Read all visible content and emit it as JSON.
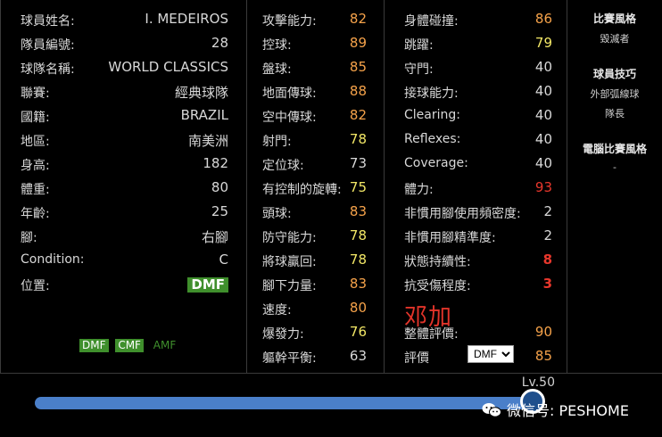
{
  "colors": {
    "orange": "#f5a24a",
    "yellow": "#f2e766",
    "white": "#d8d8d8",
    "red": "#e8372c",
    "badge": "#3f8f2c"
  },
  "profile": [
    {
      "label": "球員姓名:",
      "value": "I. MEDEIROS"
    },
    {
      "label": "隊員編號:",
      "value": "28"
    },
    {
      "label": "球隊名稱:",
      "value": "WORLD CLASSICS"
    },
    {
      "label": "聯賽:",
      "value": "經典球隊"
    },
    {
      "label": "國籍:",
      "value": "BRAZIL"
    },
    {
      "label": "地區:",
      "value": "南美洲"
    },
    {
      "label": "身高:",
      "value": "182"
    },
    {
      "label": "體重:",
      "value": "80"
    },
    {
      "label": "年齡:",
      "value": "25"
    },
    {
      "label": "腳:",
      "value": "右腳"
    },
    {
      "label": "Condition:",
      "value": "C"
    },
    {
      "label": "位置:",
      "value": "DMF"
    }
  ],
  "positions": [
    "DMF",
    "CMF",
    "AMF"
  ],
  "stats_a": [
    {
      "label": "攻擊能力:",
      "value": "82",
      "color": "orange"
    },
    {
      "label": "控球:",
      "value": "89",
      "color": "orange"
    },
    {
      "label": "盤球:",
      "value": "85",
      "color": "orange"
    },
    {
      "label": "地面傳球:",
      "value": "88",
      "color": "orange"
    },
    {
      "label": "空中傳球:",
      "value": "82",
      "color": "orange"
    },
    {
      "label": "射門:",
      "value": "78",
      "color": "yellow"
    },
    {
      "label": "定位球:",
      "value": "73",
      "color": "white"
    },
    {
      "label": "有控制的旋轉:",
      "value": "75",
      "color": "yellow"
    },
    {
      "label": "頭球:",
      "value": "83",
      "color": "orange"
    },
    {
      "label": "防守能力:",
      "value": "78",
      "color": "yellow"
    },
    {
      "label": "將球贏回:",
      "value": "78",
      "color": "yellow"
    },
    {
      "label": "腳下力量:",
      "value": "83",
      "color": "orange"
    },
    {
      "label": "速度:",
      "value": "80",
      "color": "orange"
    },
    {
      "label": "爆發力:",
      "value": "76",
      "color": "yellow"
    },
    {
      "label": "軀幹平衡:",
      "value": "63",
      "color": "white"
    }
  ],
  "stats_b": [
    {
      "label": "身體碰撞:",
      "value": "86",
      "color": "orange"
    },
    {
      "label": "跳躍:",
      "value": "79",
      "color": "yellow"
    },
    {
      "label": "守門:",
      "value": "40",
      "color": "white"
    },
    {
      "label": "接球能力:",
      "value": "40",
      "color": "white"
    },
    {
      "label": "Clearing:",
      "value": "40",
      "color": "white"
    },
    {
      "label": "Reflexes:",
      "value": "40",
      "color": "white"
    },
    {
      "label": "Coverage:",
      "value": "40",
      "color": "white"
    },
    {
      "label": "體力:",
      "value": "93",
      "color": "red"
    },
    {
      "label": "非慣用腳使用頻密度:",
      "value": "2",
      "color": "white"
    },
    {
      "label": "非慣用腳精準度:",
      "value": "2",
      "color": "white"
    },
    {
      "label": "狀態持續性:",
      "value": "8",
      "color": "red",
      "bold": true
    },
    {
      "label": "抗受傷程度:",
      "value": "3",
      "color": "red",
      "bold": true
    },
    {
      "label": "",
      "value": "",
      "color": "white"
    },
    {
      "label": "整體評價:",
      "value": "90",
      "color": "orange"
    },
    {
      "label": "評價",
      "value": "85",
      "color": "orange"
    }
  ],
  "eval_select": "DMF",
  "stamp_text": "邓加",
  "side": {
    "style_title": "比賽風格",
    "style_value": "毀滅者",
    "skills_title": "球員技巧",
    "skills": [
      "外部弧線球",
      "隊長"
    ],
    "ai_title": "電腦比賽風格",
    "ai_value": "-"
  },
  "level_label": "Lv.50",
  "level_progress": 1.0,
  "watermark": "微信号: PESHOME"
}
